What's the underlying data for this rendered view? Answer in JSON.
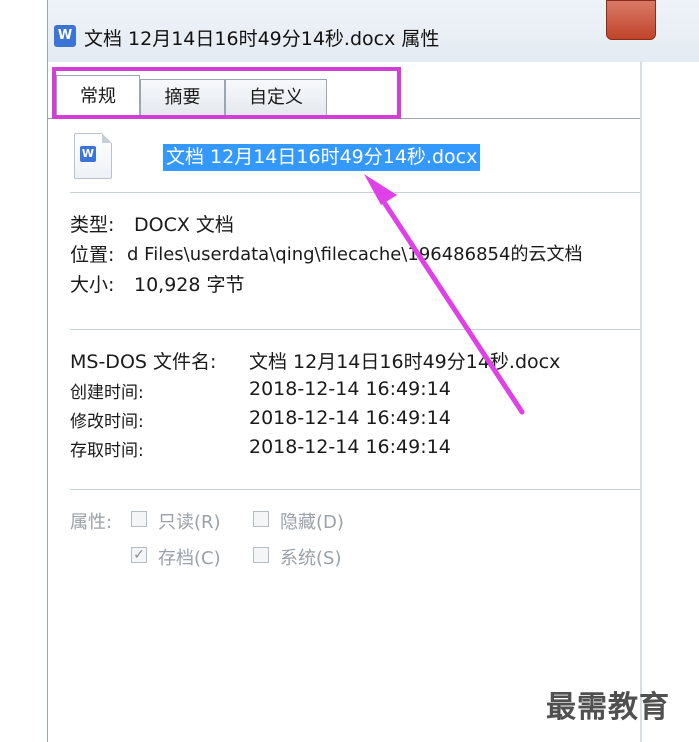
{
  "window": {
    "title": "文档 12月14日16时49分14秒.docx 属性",
    "app_icon_letter": "W"
  },
  "tabs": [
    {
      "label": "常规",
      "active": true
    },
    {
      "label": "摘要",
      "active": false
    },
    {
      "label": "自定义",
      "active": false
    }
  ],
  "file": {
    "name": "文档 12月14日16时49分14秒.docx",
    "icon_letter": "W"
  },
  "info": {
    "type_label": "类型:",
    "type_value": "DOCX 文档",
    "location_label": "位置:",
    "location_value": "d Files\\userdata\\qing\\filecache\\196486854的云文档",
    "size_label": "大小:",
    "size_value": "10,928 字节"
  },
  "details": {
    "msdos_label": "MS-DOS 文件名:",
    "msdos_value": "文档 12月14日16时49分14秒.docx",
    "created_label": "创建时间:",
    "created_value": "2018-12-14 16:49:14",
    "modified_label": "修改时间:",
    "modified_value": "2018-12-14 16:49:14",
    "accessed_label": "存取时间:",
    "accessed_value": "2018-12-14 16:49:14"
  },
  "attributes": {
    "label": "属性:",
    "readonly": {
      "label": "只读(R)",
      "checked": false
    },
    "hidden": {
      "label": "隐藏(D)",
      "checked": false
    },
    "archive": {
      "label": "存档(C)",
      "checked": true
    },
    "system": {
      "label": "系统(S)",
      "checked": false
    }
  },
  "annotation": {
    "highlight_color": "#d23fd6",
    "arrow_color": "#e040e8"
  },
  "watermark": "最需教育"
}
